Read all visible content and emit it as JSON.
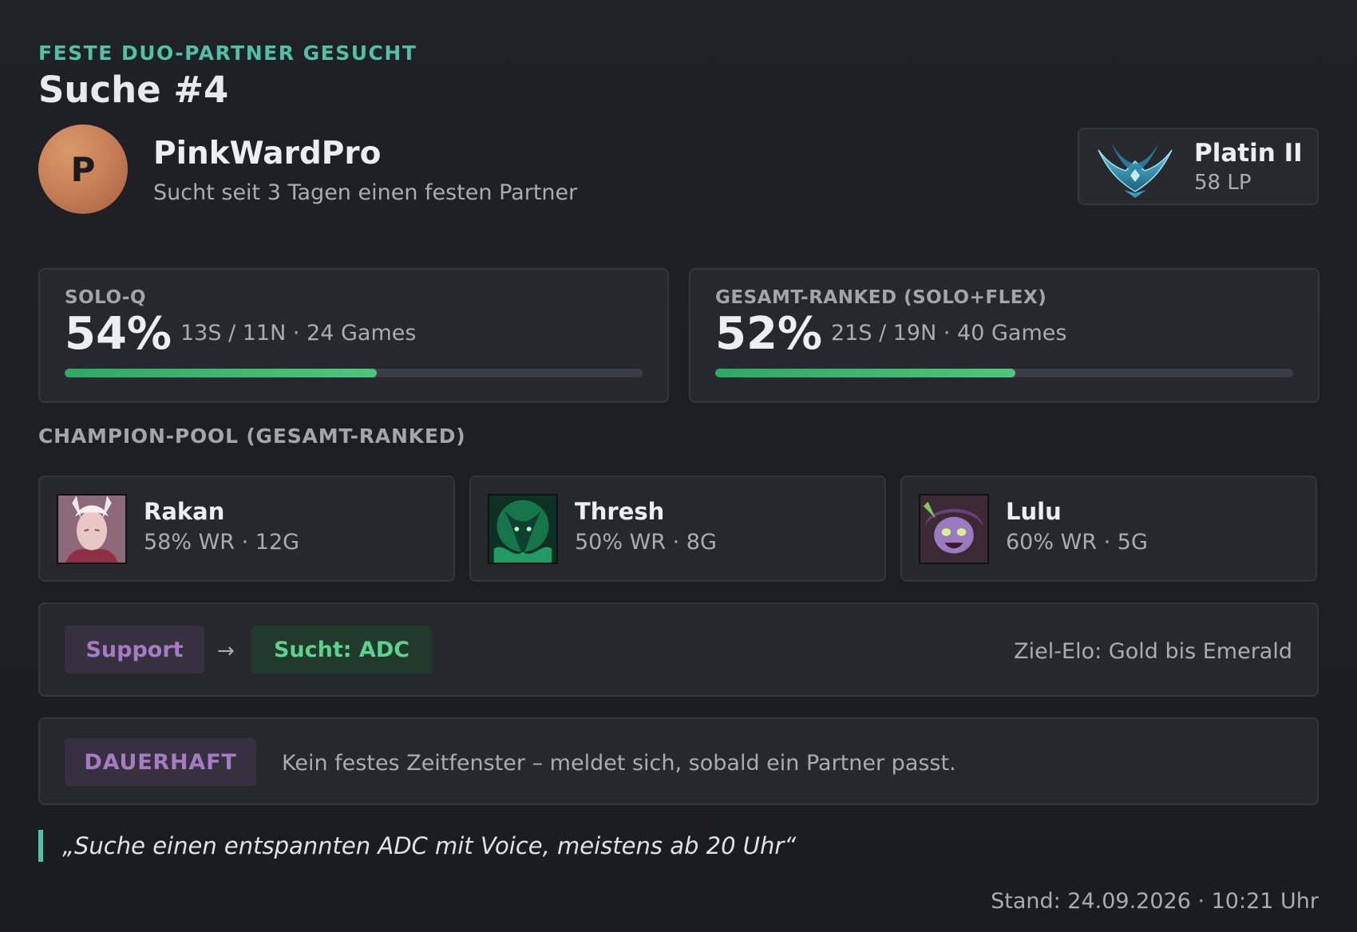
{
  "header": {
    "eyebrow": "FESTE DUO-PARTNER GESUCHT",
    "title": "Suche #4"
  },
  "player": {
    "avatar_initial": "P",
    "name": "PinkWardPro",
    "subtitle": "Sucht seit 3 Tagen einen festen Partner"
  },
  "rank": {
    "emblem_icon": "platinum-emblem-icon",
    "tier": "Platin II",
    "lp": "58 LP"
  },
  "stats": {
    "solo": {
      "label": "SOLO-Q",
      "winrate_text": "54%",
      "winrate_fraction": 0.54,
      "detail": "13S / 11N · 24 Games"
    },
    "total": {
      "label": "GESAMT-RANKED (SOLO+FLEX)",
      "winrate_text": "52%",
      "winrate_fraction": 0.52,
      "detail": "21S / 19N · 40 Games"
    }
  },
  "champion_pool": {
    "label": "CHAMPION-POOL (GESAMT-RANKED)",
    "champions": [
      {
        "name": "Rakan",
        "stats": "58% WR · 12G"
      },
      {
        "name": "Thresh",
        "stats": "50% WR · 8G"
      },
      {
        "name": "Lulu",
        "stats": "60% WR · 5G"
      }
    ]
  },
  "roles": {
    "own_role": "Support",
    "arrow": "→",
    "seeking": "Sucht: ADC",
    "target_elo": "Ziel-Elo: Gold bis Emerald"
  },
  "schedule": {
    "badge": "DAUERHAFT",
    "text": "Kein festes Zeitfenster – meldet sich, sobald ein Partner passt."
  },
  "quote": "„Suche einen entspannten ADC mit Voice, meistens ab 20 Uhr“",
  "footer": "Stand: 24.09.2026 · 10:21 Uhr",
  "colors": {
    "accent": "#4fc1a6",
    "win_bar": "#4cc57e",
    "role_purple": "#a57bc4",
    "seek_green": "#5fd18e"
  }
}
